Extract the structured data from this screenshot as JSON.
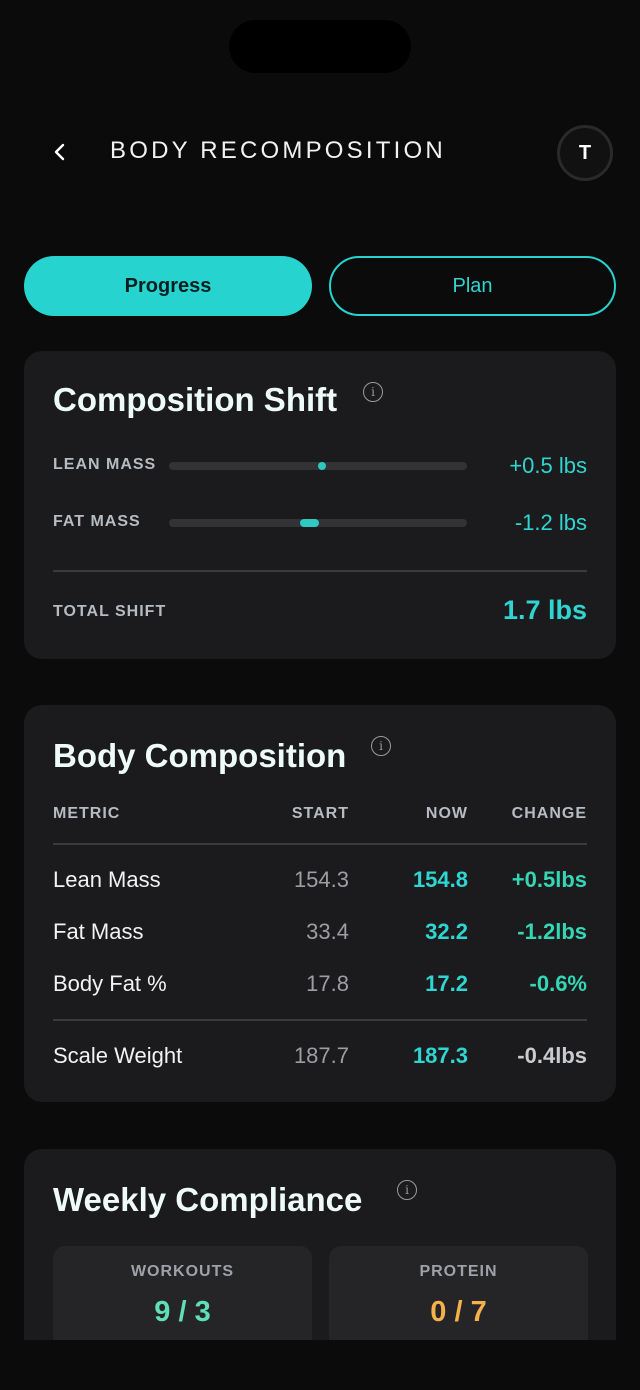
{
  "header": {
    "title": "BODY RECOMPOSITION",
    "avatar_initial": "T"
  },
  "tabs": [
    {
      "label": "Progress",
      "active": true
    },
    {
      "label": "Plan",
      "active": false
    }
  ],
  "composition_shift": {
    "title": "Composition Shift",
    "rows": [
      {
        "label": "LEAN MASS",
        "value": "+0.5 lbs"
      },
      {
        "label": "FAT MASS",
        "value": "-1.2 lbs"
      }
    ],
    "total_label": "TOTAL SHIFT",
    "total_value": "1.7 lbs"
  },
  "body_composition": {
    "title": "Body Composition",
    "columns": [
      "METRIC",
      "START",
      "NOW",
      "CHANGE"
    ],
    "rows": [
      {
        "metric": "Lean Mass",
        "start": "154.3",
        "now": "154.8",
        "change": "+0.5lbs"
      },
      {
        "metric": "Fat Mass",
        "start": "33.4",
        "now": "32.2",
        "change": "-1.2lbs"
      },
      {
        "metric": "Body Fat %",
        "start": "17.8",
        "now": "17.2",
        "change": "-0.6%"
      },
      {
        "metric": "Scale Weight",
        "start": "187.7",
        "now": "187.3",
        "change": "-0.4lbs"
      }
    ]
  },
  "weekly_compliance": {
    "title": "Weekly Compliance",
    "items": [
      {
        "label": "WORKOUTS",
        "value": "9 / 3",
        "color": "#5fe0b4"
      },
      {
        "label": "PROTEIN",
        "value": "0 / 7",
        "color": "#f5b14a"
      }
    ]
  },
  "colors": {
    "accent": "#27d3cf",
    "background": "#0b0b0b",
    "card": "#1b1b1d"
  }
}
